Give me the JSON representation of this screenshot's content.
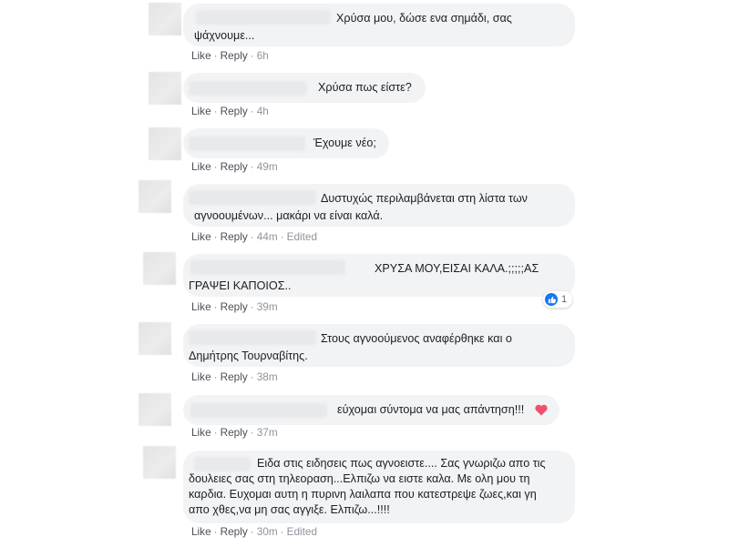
{
  "actions": {
    "like": "Like",
    "reply": "Reply",
    "dot": "·",
    "edited": "Edited"
  },
  "comments": [
    {
      "lines": [
        "Χρύσα μου, δώσε ενα σημάδι, σας",
        "ψάχνουμε..."
      ],
      "time": "6h"
    },
    {
      "lines": [
        "Χρύσα πως είστε?"
      ],
      "time": "4h"
    },
    {
      "lines": [
        "Έχουμε νέο;"
      ],
      "time": "49m"
    },
    {
      "lines": [
        "Δυστυχώς περιλαμβάνεται στη λίστα των",
        "αγνοουμένων... μακάρι να είναι καλά."
      ],
      "time": "44m",
      "edited": true
    },
    {
      "lines": [
        "ΧΡΥΣΑ ΜΟΥ,ΕΙΣΑΙ ΚΑΛΑ.;;;;;ΑΣ",
        "ΓΡΑΨΕΙ ΚΑΠΟΙΟΣ.."
      ],
      "time": "39m",
      "reaction_count": "1"
    },
    {
      "lines": [
        "Στους αγνοούμενος αναφέρθηκε και ο",
        "Δημήτρης Τουρναβίτης."
      ],
      "time": "38m"
    },
    {
      "lines": [
        "εύχομαι σύντομα να μας απάντηση!!!"
      ],
      "time": "37m",
      "heart_color": "#f0506e"
    },
    {
      "lines": [
        "Ειδα στις ειδησεις πως αγνοειστε.... Σας γνωριζω απο τις",
        "δουλειες σας στη τηλεοραση...Ελπιζω να ειστε καλα. Με ολη μου τη",
        "καρδια. Ευχομαι αυτη η πυρινη λαιλαπα που κατεστρεψε ζωες,και γη",
        "απο χθες,να μη σας αγγιξε. Ελπιζω...!!!!"
      ],
      "time": "30m",
      "edited": true
    }
  ]
}
